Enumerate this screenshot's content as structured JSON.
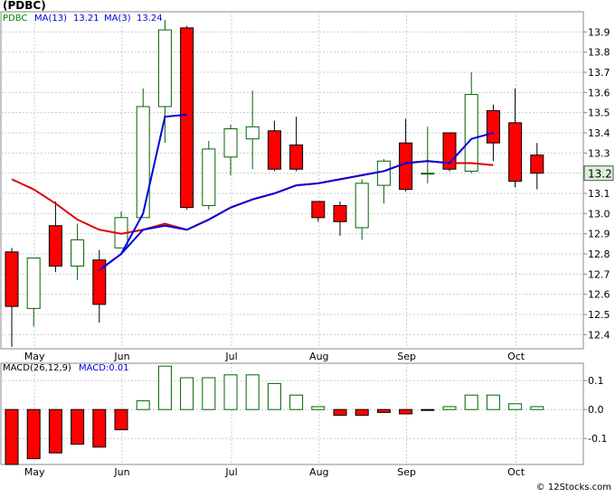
{
  "header": {
    "ticker": "(PDBC)",
    "symbol": "PDBC",
    "ma13_label": "MA(13)",
    "ma13_value": "13.21",
    "ma3_label": "MA(3)",
    "ma3_value": "13.24"
  },
  "macd_header": {
    "label": "MACD(26,12,9)",
    "value_label": "MACD:0.01"
  },
  "last_price_label": "13.2",
  "footer": "© 12Stocks.com",
  "colors": {
    "up": "#ffffff",
    "up_border": "#006400",
    "down": "#ff0000",
    "down_border": "#000000",
    "ma13": "#0000dd",
    "ma3": "#dd0000",
    "grid": "#cccccc",
    "axis_box": "#d8f0d8"
  },
  "chart_data": [
    {
      "type": "candlestick",
      "title": "(PDBC)",
      "y_ticks": [
        "12.4",
        "12.5",
        "12.6",
        "12.7",
        "12.8",
        "12.9",
        "13.0",
        "13.1",
        "13.2",
        "13.3",
        "13.4",
        "13.5",
        "13.6",
        "13.7",
        "13.8",
        "13.9"
      ],
      "ylim": [
        12.33,
        14.0
      ],
      "x_labels": [
        "May",
        "Jun",
        "Jul",
        "Aug",
        "Sep",
        "Oct"
      ],
      "x_label_index": [
        1,
        5,
        10,
        14,
        18,
        23
      ],
      "grid": true,
      "candles": [
        {
          "open": 12.81,
          "high": 12.83,
          "low": 12.34,
          "close": 12.54
        },
        {
          "open": 12.53,
          "high": 12.78,
          "low": 12.44,
          "close": 12.78
        },
        {
          "open": 12.94,
          "high": 13.06,
          "low": 12.71,
          "close": 12.74
        },
        {
          "open": 12.74,
          "high": 12.95,
          "low": 12.67,
          "close": 12.87
        },
        {
          "open": 12.77,
          "high": 12.82,
          "low": 12.46,
          "close": 12.55
        },
        {
          "open": 12.83,
          "high": 13.01,
          "low": 12.83,
          "close": 12.98
        },
        {
          "open": 12.98,
          "high": 13.62,
          "low": 12.98,
          "close": 13.53
        },
        {
          "open": 13.53,
          "high": 13.96,
          "low": 13.35,
          "close": 13.91
        },
        {
          "open": 13.92,
          "high": 13.93,
          "low": 13.02,
          "close": 13.03
        },
        {
          "open": 13.04,
          "high": 13.36,
          "low": 13.02,
          "close": 13.32
        },
        {
          "open": 13.28,
          "high": 13.44,
          "low": 13.19,
          "close": 13.42
        },
        {
          "open": 13.37,
          "high": 13.61,
          "low": 13.22,
          "close": 13.43
        },
        {
          "open": 13.41,
          "high": 13.46,
          "low": 13.21,
          "close": 13.22
        },
        {
          "open": 13.34,
          "high": 13.48,
          "low": 13.21,
          "close": 13.22
        },
        {
          "open": 13.06,
          "high": 13.06,
          "low": 12.96,
          "close": 12.98
        },
        {
          "open": 13.04,
          "high": 13.06,
          "low": 12.89,
          "close": 12.96
        },
        {
          "open": 12.93,
          "high": 13.17,
          "low": 12.87,
          "close": 13.15
        },
        {
          "open": 13.14,
          "high": 13.27,
          "low": 13.05,
          "close": 13.26
        },
        {
          "open": 13.35,
          "high": 13.47,
          "low": 13.11,
          "close": 13.12
        },
        {
          "open": 13.2,
          "high": 13.43,
          "low": 13.15,
          "close": 13.2
        },
        {
          "open": 13.4,
          "high": 13.4,
          "low": 13.21,
          "close": 13.22
        },
        {
          "open": 13.21,
          "high": 13.7,
          "low": 13.2,
          "close": 13.59
        },
        {
          "open": 13.51,
          "high": 13.54,
          "low": 13.26,
          "close": 13.35
        },
        {
          "open": 13.45,
          "high": 13.62,
          "low": 13.13,
          "close": 13.16
        },
        {
          "open": 13.29,
          "high": 13.35,
          "low": 13.12,
          "close": 13.2
        }
      ],
      "series": [
        {
          "name": "MA(13)",
          "values": [
            null,
            null,
            null,
            null,
            12.72,
            12.8,
            12.91,
            13.49,
            13.49,
            null,
            null,
            null,
            null,
            null,
            null,
            null,
            null,
            null,
            null,
            null,
            null,
            null,
            null,
            null,
            null
          ]
        },
        {
          "name": "MA(3)",
          "values": [
            null,
            null,
            null,
            null,
            null,
            null,
            null,
            null,
            null,
            null,
            null,
            null,
            null,
            null,
            null,
            null,
            null,
            null,
            null,
            null,
            null,
            null,
            null,
            null,
            null
          ]
        }
      ],
      "ma13_line": [
        [
          4,
          12.72
        ],
        [
          5,
          12.8
        ],
        [
          6,
          12.91
        ],
        [
          7,
          13.48
        ],
        [
          8,
          13.49
        ]
      ],
      "ma13_line_late": [
        [
          4,
          12.72
        ],
        [
          5,
          12.8
        ],
        [
          6,
          12.91
        ],
        [
          7,
          13.48
        ]
      ],
      "blue_line": [
        [
          4,
          12.72
        ],
        [
          5,
          12.8
        ],
        [
          6,
          12.92
        ],
        [
          7,
          12.94
        ],
        [
          8,
          12.92
        ],
        [
          9,
          12.97
        ],
        [
          10,
          13.03
        ],
        [
          11,
          13.07
        ],
        [
          12,
          13.1
        ],
        [
          13,
          13.14
        ],
        [
          14,
          13.15
        ],
        [
          15,
          13.17
        ],
        [
          16,
          13.19
        ],
        [
          17,
          13.21
        ],
        [
          18,
          13.25
        ],
        [
          19,
          13.26
        ],
        [
          20,
          13.25
        ],
        [
          21,
          13.37
        ],
        [
          22,
          13.4
        ]
      ],
      "blue_line_pre": [
        [
          4,
          12.72
        ],
        [
          5,
          12.8
        ],
        [
          6,
          13.0
        ],
        [
          7,
          13.48
        ],
        [
          8,
          13.49
        ]
      ],
      "red_line": [
        [
          0,
          13.17
        ],
        [
          1,
          13.12
        ],
        [
          2,
          13.05
        ],
        [
          3,
          12.97
        ],
        [
          4,
          12.92
        ],
        [
          5,
          12.9
        ],
        [
          6,
          12.92
        ],
        [
          7,
          12.95
        ],
        [
          8,
          12.92
        ],
        [
          9,
          12.97
        ],
        [
          10,
          13.03
        ],
        [
          11,
          13.07
        ],
        [
          12,
          13.1
        ],
        [
          13,
          13.14
        ],
        [
          14,
          13.15
        ],
        [
          15,
          13.17
        ],
        [
          16,
          13.19
        ],
        [
          17,
          13.21
        ],
        [
          18,
          13.25
        ],
        [
          19,
          13.26
        ],
        [
          20,
          13.25
        ],
        [
          21,
          13.25
        ],
        [
          22,
          13.24
        ]
      ]
    },
    {
      "type": "bar",
      "title": "MACD(26,12,9)",
      "y_ticks": [
        "0.1",
        "0.0",
        "-0.1"
      ],
      "ylim": [
        -0.19,
        0.16
      ],
      "x_labels": [
        "May",
        "Jun",
        "Jul",
        "Aug",
        "Sep",
        "Oct"
      ],
      "values": [
        -0.19,
        -0.17,
        -0.15,
        -0.12,
        -0.13,
        -0.07,
        0.03,
        0.15,
        0.11,
        0.11,
        0.12,
        0.12,
        0.09,
        0.05,
        0.01,
        -0.02,
        -0.02,
        -0.01,
        -0.015,
        -0.002,
        0.01,
        0.05,
        0.05,
        0.02,
        0.01
      ]
    }
  ]
}
